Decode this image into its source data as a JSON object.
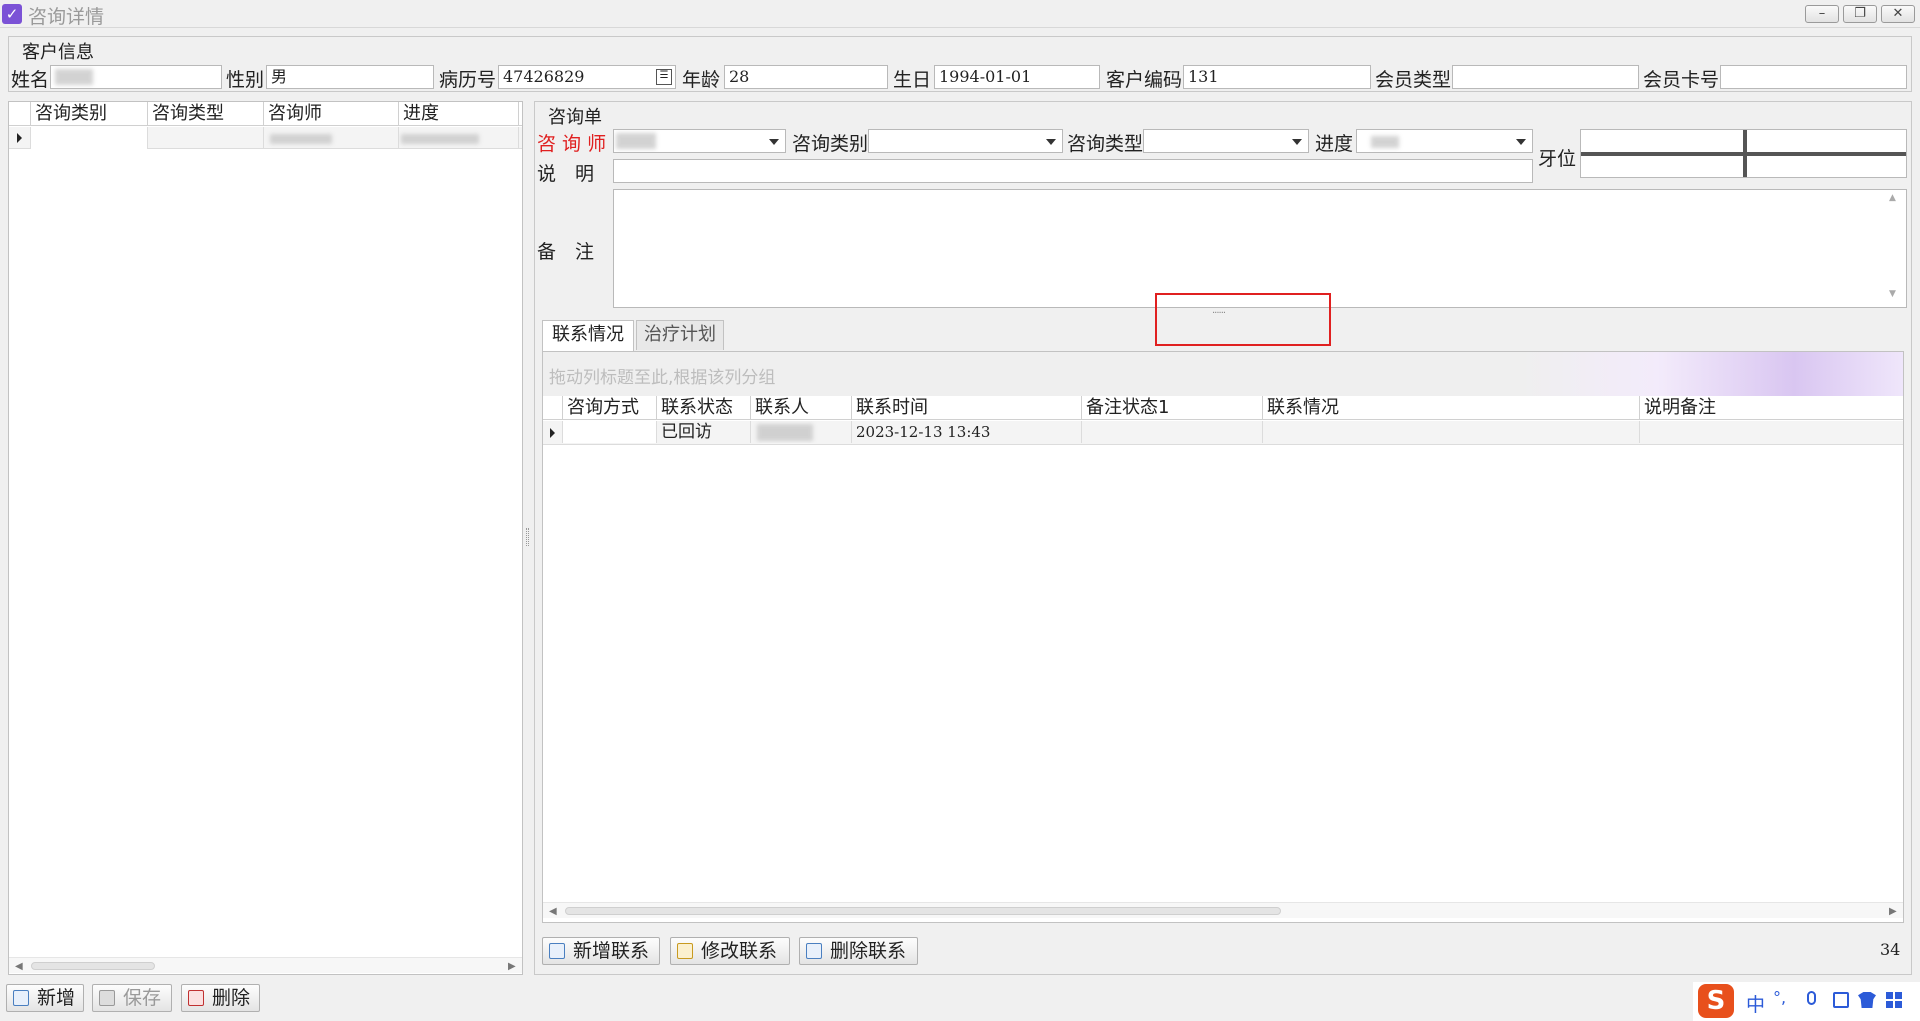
{
  "window": {
    "title": "咨询详情",
    "minimize": "–",
    "restore": "❐",
    "close": "✕"
  },
  "customer": {
    "group_title": "客户信息",
    "name_label": "姓名",
    "name_value": "",
    "gender_label": "性别",
    "gender_value": "男",
    "record_label": "病历号",
    "record_value": "47426829",
    "age_label": "年龄",
    "age_value": "28",
    "birthday_label": "生日",
    "birthday_value": "1994-01-01",
    "code_label": "客户编码",
    "code_value": "131",
    "member_type_label": "会员类型",
    "member_type_value": "",
    "member_card_label": "会员卡号",
    "member_card_value": ""
  },
  "left_grid": {
    "columns": [
      "咨询类别",
      "咨询类型",
      "咨询师",
      "进度"
    ]
  },
  "consult_form": {
    "group_title": "咨询单",
    "consultant_label": "咨 询 师",
    "category_label": "咨询类别",
    "type_label": "咨询类型",
    "progress_label": "进度",
    "tooth_label": "牙位",
    "desc_label": "说　明",
    "note_label": "备　注",
    "desc_value": "",
    "note_value": "",
    "splitter_grip": "......"
  },
  "tabs": [
    {
      "label": "联系情况",
      "active": true
    },
    {
      "label": "治疗计划",
      "active": false
    }
  ],
  "contact_grid": {
    "group_panel_hint": "拖动列标题至此,根据该列分组",
    "columns": [
      "咨询方式",
      "联系状态",
      "联系人",
      "联系时间",
      "备注状态1",
      "联系情况",
      "说明备注"
    ],
    "rows": [
      {
        "method": "",
        "status": "已回访",
        "contact": "",
        "time": "2023-12-13 13:43",
        "note_status": "",
        "situation": "",
        "remark": ""
      }
    ]
  },
  "contact_buttons": {
    "add": "新增联系",
    "edit": "修改联系",
    "delete": "删除联系"
  },
  "record_count": "34",
  "bottom_buttons": {
    "new": "新增",
    "save": "保存",
    "delete": "删除"
  },
  "ime": {
    "logo": "S",
    "mode": "中",
    "punct": "°,"
  },
  "colors": {
    "required_label": "#e02020",
    "highlight_box": "#e02020",
    "ime_logo": "#e8501c",
    "ime_icons": "#2c5bd8"
  }
}
